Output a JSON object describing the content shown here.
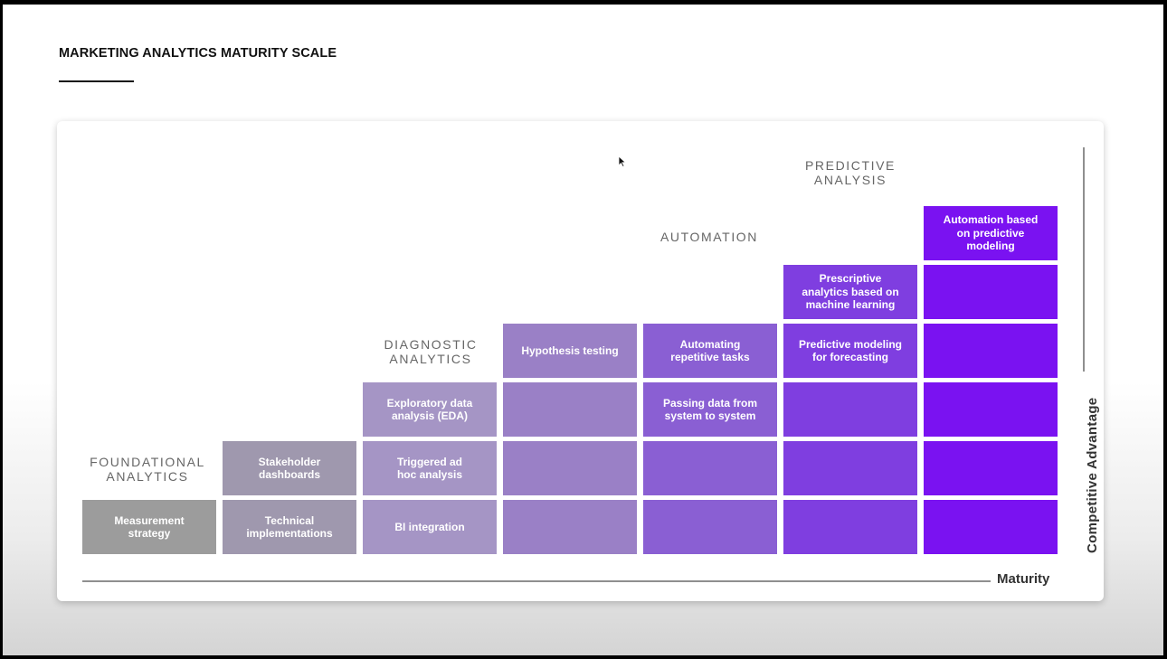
{
  "slide": {
    "title": "MARKETING ANALYTICS MATURITY SCALE"
  },
  "stages": [
    {
      "label": "FOUNDATIONAL\nANALYTICS"
    },
    {
      "label": "DIAGNOSTIC\nANALYTICS"
    },
    {
      "label": "AUTOMATION"
    },
    {
      "label": "PREDICTIVE\nANALYSIS"
    }
  ],
  "axes": {
    "x_label": "Maturity",
    "y_label": "Competitive Advantage"
  },
  "columns": [
    {
      "color": "#9c9c9c",
      "cells": [
        "Measurement\nstrategy"
      ]
    },
    {
      "color": "#9f98ae",
      "cells": [
        "Technical\nimplementations",
        "Stakeholder\ndashboards"
      ]
    },
    {
      "color": "#a595c5",
      "cells": [
        "BI integration",
        "Triggered ad\nhoc analysis",
        "Exploratory data\nanalysis (EDA)"
      ]
    },
    {
      "color": "#9a80c6",
      "cells": [
        "",
        "",
        "",
        "Hypothesis testing"
      ]
    },
    {
      "color": "#8a5fd3",
      "cells": [
        "",
        "",
        "Passing data from\nsystem to system",
        "Automating\nrepetitive tasks"
      ]
    },
    {
      "color": "#7f3ee0",
      "cells": [
        "",
        "",
        "",
        "Predictive modeling\nfor forecasting",
        "Prescriptive\nanalytics based on\nmachine learning"
      ]
    },
    {
      "color": "#7a12f1",
      "cells": [
        "",
        "",
        "",
        "",
        "",
        "Automation based\non predictive\nmodeling"
      ]
    }
  ]
}
